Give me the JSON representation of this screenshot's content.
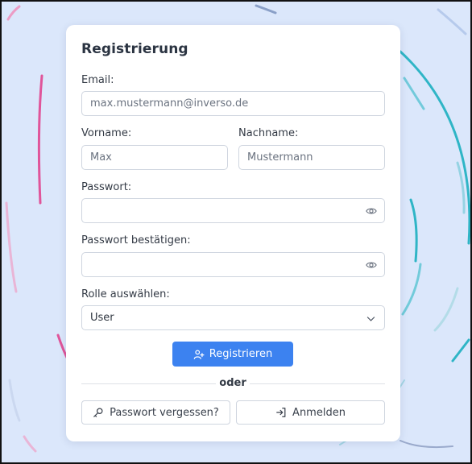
{
  "form": {
    "title": "Registrierung",
    "email": {
      "label": "Email:",
      "placeholder": "max.mustermann@inverso.de"
    },
    "first_name": {
      "label": "Vorname:",
      "placeholder": "Max"
    },
    "last_name": {
      "label": "Nachname:",
      "placeholder": "Mustermann"
    },
    "password": {
      "label": "Passwort:",
      "value": "",
      "icon": "eye-icon"
    },
    "password_confirm": {
      "label": "Passwort bestätigen:",
      "value": "",
      "icon": "eye-icon"
    },
    "role": {
      "label": "Rolle auswählen:",
      "selected": "User",
      "icon": "chevron-down-icon"
    },
    "register_button": {
      "label": "Registrieren",
      "icon": "user-plus-icon"
    },
    "divider_text": "oder",
    "forgot_password_button": {
      "label": "Passwort vergessen?",
      "icon": "key-icon"
    },
    "login_button": {
      "label": "Anmelden",
      "icon": "login-arrow-icon"
    }
  },
  "colors": {
    "background": "#dbe7fb",
    "card": "#ffffff",
    "primary": "#3c82f0",
    "accent_teal": "#2fb5c6",
    "accent_pink": "#e0559a"
  }
}
